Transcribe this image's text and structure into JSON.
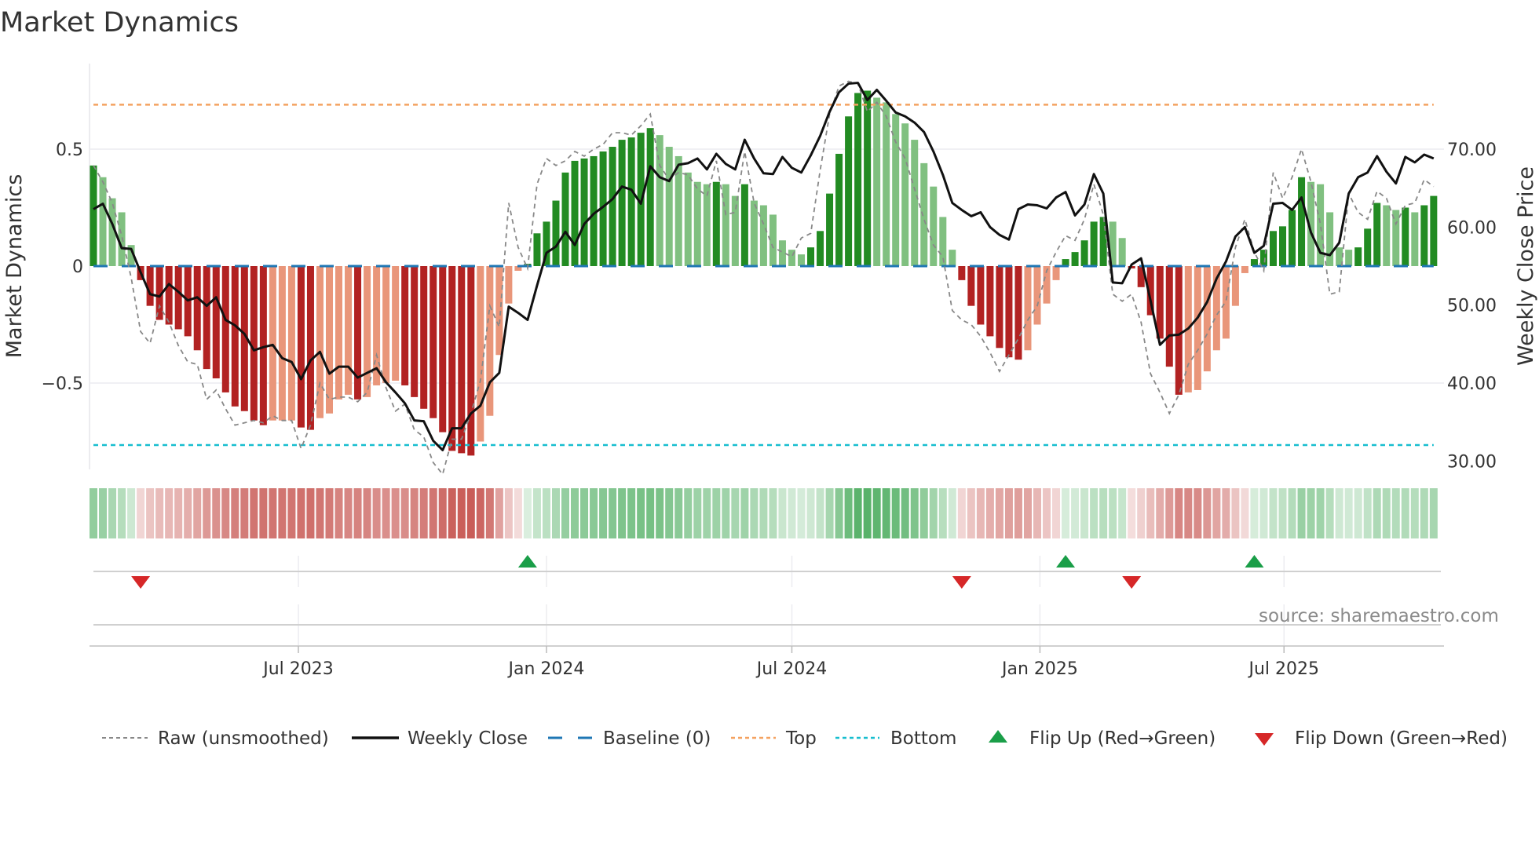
{
  "title": "Market Dynamics",
  "source": "source: sharemaestro.com",
  "legend": {
    "raw": "Raw (unsmoothed)",
    "close": "Weekly Close",
    "baseline": "Baseline (0)",
    "top": "Top",
    "bottom": "Bottom",
    "flip_up": "Flip Up (Red→Green)",
    "flip_down": "Flip Down (Green→Red)"
  },
  "colors": {
    "strong_green": "#228b22",
    "weak_green": "#80c080",
    "strong_red": "#b22222",
    "weak_red": "#e9967a",
    "close": "#111111",
    "raw": "#888888",
    "baseline": "#1f77b4",
    "top": "#f4a261",
    "bottom": "#17becf",
    "flip_up": "#1a9e48",
    "flip_down": "#d62728"
  },
  "chart_data": {
    "type": "bar+line",
    "title": "Market Dynamics",
    "ylabel": "Market Dynamics",
    "ylabel_right": "Weekly Close Price",
    "start_week": "2023-01-30",
    "frequency": "weekly",
    "ylim": [
      -0.87,
      0.87
    ],
    "ylim_right": [
      29.3,
      79.3
    ],
    "y_ticks": [
      {
        "value": 0.5,
        "label": "0.5"
      },
      {
        "value": 0,
        "label": "0"
      },
      {
        "value": -0.5,
        "label": "−0.5"
      }
    ],
    "y_ticks_right": [
      {
        "value": 70,
        "label": "70.00"
      },
      {
        "value": 60,
        "label": "60.00"
      },
      {
        "value": 50,
        "label": "50.00"
      },
      {
        "value": 40,
        "label": "40.00"
      },
      {
        "value": 30,
        "label": "30.00"
      }
    ],
    "x_ticks": [
      {
        "date": "2023-07-01",
        "label": "Jul 2023"
      },
      {
        "date": "2024-01-01",
        "label": "Jan 2024"
      },
      {
        "date": "2024-07-01",
        "label": "Jul 2024"
      },
      {
        "date": "2025-01-01",
        "label": "Jan 2025"
      },
      {
        "date": "2025-07-01",
        "label": "Jul 2025"
      }
    ],
    "top_level": 0.69,
    "bottom_level": -0.765,
    "baseline": 0,
    "dynamics": [
      0.43,
      0.38,
      0.29,
      0.23,
      0.09,
      -0.06,
      -0.17,
      -0.23,
      -0.25,
      -0.27,
      -0.3,
      -0.36,
      -0.44,
      -0.48,
      -0.54,
      -0.6,
      -0.62,
      -0.66,
      -0.68,
      -0.66,
      -0.66,
      -0.66,
      -0.69,
      -0.7,
      -0.65,
      -0.63,
      -0.57,
      -0.55,
      -0.57,
      -0.56,
      -0.51,
      -0.5,
      -0.49,
      -0.51,
      -0.56,
      -0.61,
      -0.65,
      -0.71,
      -0.79,
      -0.8,
      -0.81,
      -0.75,
      -0.64,
      -0.38,
      -0.16,
      -0.02,
      0.01,
      0.14,
      0.19,
      0.28,
      0.4,
      0.45,
      0.46,
      0.47,
      0.49,
      0.51,
      0.54,
      0.55,
      0.57,
      0.59,
      0.56,
      0.51,
      0.47,
      0.4,
      0.36,
      0.35,
      0.36,
      0.35,
      0.3,
      0.35,
      0.28,
      0.26,
      0.22,
      0.11,
      0.07,
      0.05,
      0.08,
      0.15,
      0.31,
      0.48,
      0.64,
      0.74,
      0.75,
      0.72,
      0.7,
      0.65,
      0.61,
      0.54,
      0.44,
      0.34,
      0.21,
      0.07,
      -0.06,
      -0.17,
      -0.25,
      -0.3,
      -0.35,
      -0.39,
      -0.4,
      -0.36,
      -0.25,
      -0.16,
      -0.06,
      0.03,
      0.06,
      0.11,
      0.19,
      0.21,
      0.19,
      0.12,
      -0.01,
      -0.09,
      -0.21,
      -0.31,
      -0.43,
      -0.55,
      -0.54,
      -0.53,
      -0.45,
      -0.36,
      -0.31,
      -0.17,
      -0.03,
      0.03,
      0.07,
      0.15,
      0.17,
      0.24,
      0.38,
      0.36,
      0.35,
      0.23,
      0.08,
      0.07,
      0.08,
      0.16,
      0.27,
      0.26,
      0.24,
      0.25,
      0.23,
      0.26,
      0.3
    ],
    "raw": [
      0.43,
      0.36,
      0.27,
      0.13,
      -0.05,
      -0.28,
      -0.33,
      -0.17,
      -0.24,
      -0.34,
      -0.41,
      -0.42,
      -0.57,
      -0.53,
      -0.61,
      -0.68,
      -0.67,
      -0.66,
      -0.67,
      -0.64,
      -0.66,
      -0.66,
      -0.78,
      -0.68,
      -0.5,
      -0.57,
      -0.56,
      -0.56,
      -0.58,
      -0.54,
      -0.38,
      -0.52,
      -0.62,
      -0.59,
      -0.7,
      -0.73,
      -0.84,
      -0.89,
      -0.74,
      -0.74,
      -0.63,
      -0.49,
      -0.17,
      -0.26,
      0.27,
      0.08,
      -0.01,
      0.35,
      0.46,
      0.43,
      0.45,
      0.49,
      0.47,
      0.5,
      0.52,
      0.57,
      0.57,
      0.56,
      0.6,
      0.65,
      0.43,
      0.37,
      0.4,
      0.39,
      0.33,
      0.3,
      0.45,
      0.22,
      0.23,
      0.49,
      0.27,
      0.18,
      0.08,
      0.06,
      0.04,
      0.12,
      0.14,
      0.41,
      0.65,
      0.77,
      0.79,
      0.78,
      0.66,
      0.7,
      0.64,
      0.53,
      0.46,
      0.33,
      0.2,
      0.09,
      0.04,
      -0.19,
      -0.23,
      -0.25,
      -0.3,
      -0.37,
      -0.45,
      -0.38,
      -0.31,
      -0.23,
      -0.17,
      -0.02,
      0.06,
      0.13,
      0.11,
      0.2,
      0.35,
      0.22,
      -0.12,
      -0.15,
      -0.12,
      -0.24,
      -0.46,
      -0.54,
      -0.63,
      -0.55,
      -0.42,
      -0.36,
      -0.29,
      -0.21,
      -0.15,
      0.08,
      0.2,
      0.06,
      -0.02,
      0.4,
      0.29,
      0.38,
      0.5,
      0.36,
      0.18,
      -0.12,
      -0.11,
      0.31,
      0.23,
      0.2,
      0.32,
      0.29,
      0.18,
      0.26,
      0.27,
      0.37,
      0.34
    ],
    "close": [
      62.3,
      63.0,
      60.4,
      57.3,
      57.2,
      54.2,
      51.4,
      51.1,
      52.7,
      51.7,
      50.6,
      51.0,
      49.9,
      51.0,
      48.1,
      47.4,
      46.3,
      44.2,
      44.6,
      44.9,
      43.2,
      42.7,
      40.5,
      42.9,
      44.0,
      41.2,
      42.1,
      42.1,
      40.7,
      41.3,
      41.9,
      40.1,
      38.8,
      37.4,
      35.2,
      35.1,
      32.6,
      31.4,
      34.2,
      34.2,
      36.1,
      37.1,
      40.1,
      41.3,
      49.8,
      49.0,
      48.1,
      52.5,
      56.7,
      57.5,
      59.4,
      57.7,
      60.4,
      61.7,
      62.6,
      63.6,
      65.2,
      64.8,
      63.0,
      67.8,
      66.4,
      65.9,
      68.0,
      68.2,
      68.8,
      67.4,
      69.4,
      68.1,
      67.4,
      71.2,
      68.8,
      66.9,
      66.8,
      69.0,
      67.6,
      67.0,
      69.2,
      71.7,
      74.8,
      77.3,
      78.4,
      78.5,
      76.3,
      77.6,
      76.2,
      74.7,
      74.2,
      73.4,
      72.2,
      69.7,
      66.7,
      63.1,
      62.2,
      61.4,
      61.9,
      60.0,
      59.0,
      58.4,
      62.3,
      62.9,
      62.8,
      62.4,
      63.8,
      64.5,
      61.5,
      62.9,
      66.8,
      64.3,
      52.9,
      52.8,
      55.2,
      56.0,
      50.6,
      44.9,
      46.1,
      46.2,
      47.0,
      48.4,
      50.4,
      53.4,
      55.6,
      58.8,
      60.0,
      56.7,
      57.6,
      63.0,
      63.1,
      62.2,
      63.8,
      59.3,
      56.7,
      56.4,
      58.0,
      64.3,
      66.4,
      67.0,
      69.1,
      67.1,
      65.6,
      69.0,
      68.3,
      69.3,
      68.8
    ]
  }
}
